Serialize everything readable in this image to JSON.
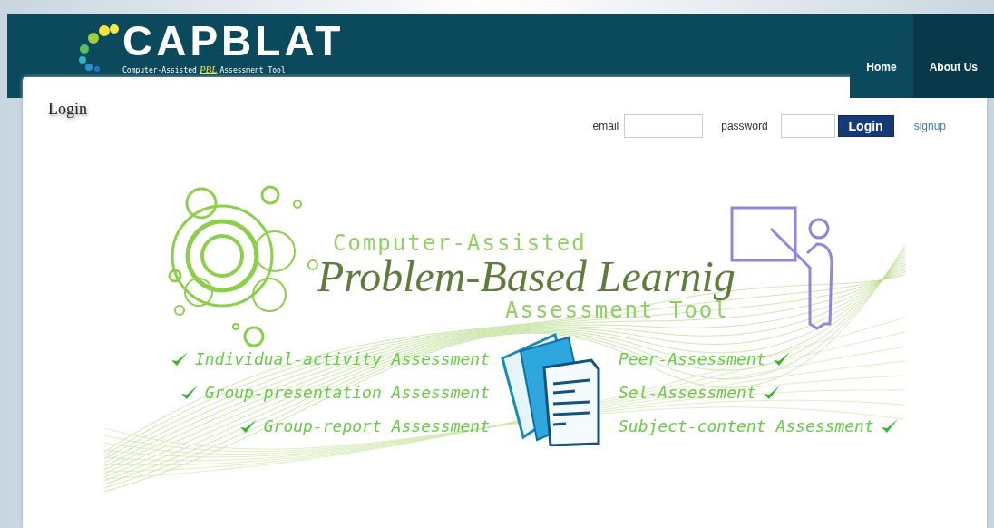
{
  "header": {
    "logo": {
      "title": "CAPBLAT",
      "subtitle_before": "Computer-Assisted",
      "subtitle_highlight": "PBL",
      "subtitle_after": "Assessment Tool"
    },
    "nav": [
      {
        "label": "Home",
        "selected": false
      },
      {
        "label": "About Us",
        "selected": true
      }
    ]
  },
  "login": {
    "heading": "Login",
    "email_label": "email",
    "password_label": "password",
    "button": "Login",
    "signup": "signup"
  },
  "banner": {
    "line_1": "Computer-Assisted",
    "line_2": "Problem-Based Learnig",
    "line_3": "Assessment Tool",
    "features_left": [
      "Individual-activity Assessment",
      "Group-presentation Assessment",
      "Group-report Assessment"
    ],
    "features_right": [
      "Peer-Assessment",
      "Sel-Assessment",
      "Subject-content Assessment"
    ]
  }
}
